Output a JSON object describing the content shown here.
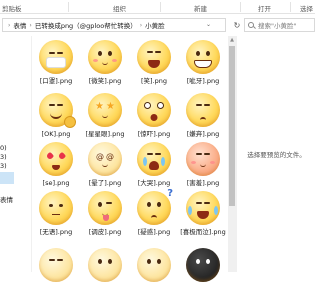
{
  "ribbon": {
    "groups": [
      "剪贴板",
      "组织",
      "新建",
      "打开",
      "选择"
    ]
  },
  "address_bar": {
    "crumbs": [
      "表情",
      "已转换成png（@gploo帮忙转换）",
      "小黄脸"
    ],
    "separator": "›"
  },
  "search": {
    "placeholder": "搜索\"小黄脸\""
  },
  "nav_pane": {
    "fragments": [
      "0)",
      "3)",
      "3)",
      "表情"
    ]
  },
  "files": [
    {
      "name": "[口罩].png",
      "face": "mask"
    },
    {
      "name": "[微笑].png",
      "face": "smile"
    },
    {
      "name": "[笑].png",
      "face": "laugh"
    },
    {
      "name": "[呲牙].png",
      "face": "grin"
    },
    {
      "name": "[OK].png",
      "face": "ok"
    },
    {
      "name": "[星星眼].png",
      "face": "stars"
    },
    {
      "name": "[惊吓].png",
      "face": "shock"
    },
    {
      "name": "[嫌弃].png",
      "face": "disgust"
    },
    {
      "name": "[se].png",
      "face": "love"
    },
    {
      "name": "[晕了].png",
      "face": "dizzy"
    },
    {
      "name": "[大哭].png",
      "face": "cry"
    },
    {
      "name": "[害羞].png",
      "face": "shy"
    },
    {
      "name": "[无语].png",
      "face": "speechless"
    },
    {
      "name": "[调皮].png",
      "face": "naughty"
    },
    {
      "name": "[疑惑].png",
      "face": "confused"
    },
    {
      "name": "[喜极而泣].png",
      "face": "tearsofjoy"
    },
    {
      "name": "",
      "face": "pale"
    },
    {
      "name": "",
      "face": "pale"
    },
    {
      "name": "",
      "face": "pale"
    },
    {
      "name": "",
      "face": "dark"
    }
  ],
  "preview": {
    "message": "选择要预览的文件。"
  }
}
